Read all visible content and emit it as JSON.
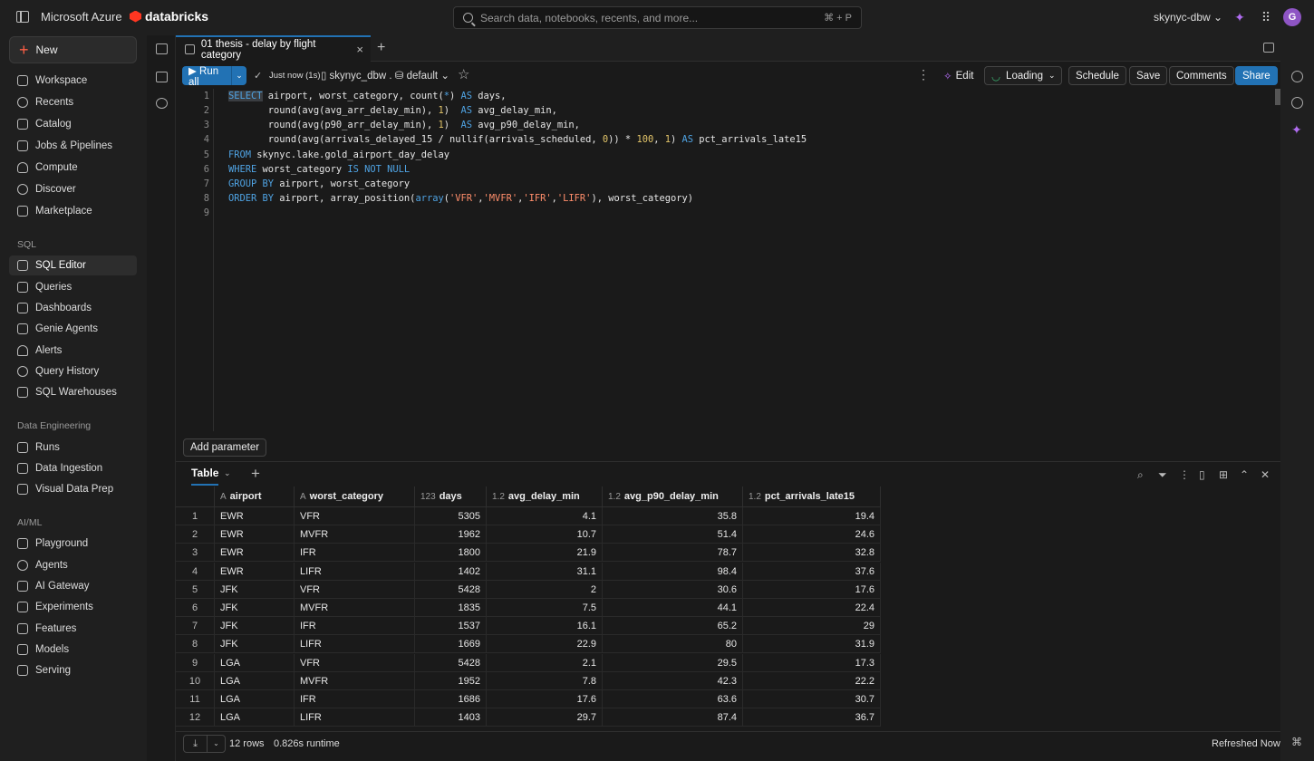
{
  "topbar": {
    "cloud_brand": "Microsoft Azure",
    "product_brand": "databricks",
    "search_placeholder": "Search data, notebooks, recents, and more...",
    "search_shortcut": "⌘ + P",
    "workspace": "skynyc-dbw",
    "avatar_initial": "G"
  },
  "sidebar": {
    "new_label": "New",
    "items_main": [
      "Workspace",
      "Recents",
      "Catalog",
      "Jobs & Pipelines",
      "Compute",
      "Discover",
      "Marketplace"
    ],
    "section_sql": "SQL",
    "items_sql": [
      "SQL Editor",
      "Queries",
      "Dashboards",
      "Genie Agents",
      "Alerts",
      "Query History",
      "SQL Warehouses"
    ],
    "section_de": "Data Engineering",
    "items_de": [
      "Runs",
      "Data Ingestion",
      "Visual Data Prep"
    ],
    "section_ai": "AI/ML",
    "items_ai": [
      "Playground",
      "Agents",
      "AI Gateway",
      "Experiments",
      "Features",
      "Models",
      "Serving"
    ],
    "active_item": "SQL Editor"
  },
  "tab": {
    "title": "01 thesis - delay by flight category"
  },
  "toolbar": {
    "run_all": "Run all",
    "status": "Just now (1s)",
    "catalog": "skynyc_dbw",
    "schema": "default",
    "edit": "Edit",
    "warehouse": "Loading",
    "schedule": "Schedule",
    "save": "Save",
    "comments": "Comments",
    "share": "Share"
  },
  "editor": {
    "line_numbers": [
      "1",
      "2",
      "3",
      "4",
      "5",
      "6",
      "7",
      "8",
      "9"
    ]
  },
  "add_parameter": "Add parameter",
  "results": {
    "tab_label": "Table",
    "columns": [
      {
        "name": "airport",
        "type_tag": "A"
      },
      {
        "name": "worst_category",
        "type_tag": "A"
      },
      {
        "name": "days",
        "type_tag": "123"
      },
      {
        "name": "avg_delay_min",
        "type_tag": "1.2"
      },
      {
        "name": "avg_p90_delay_min",
        "type_tag": "1.2"
      },
      {
        "name": "pct_arrivals_late15",
        "type_tag": "1.2"
      }
    ],
    "rows": [
      [
        "1",
        "EWR",
        "VFR",
        "5305",
        "4.1",
        "35.8",
        "19.4"
      ],
      [
        "2",
        "EWR",
        "MVFR",
        "1962",
        "10.7",
        "51.4",
        "24.6"
      ],
      [
        "3",
        "EWR",
        "IFR",
        "1800",
        "21.9",
        "78.7",
        "32.8"
      ],
      [
        "4",
        "EWR",
        "LIFR",
        "1402",
        "31.1",
        "98.4",
        "37.6"
      ],
      [
        "5",
        "JFK",
        "VFR",
        "5428",
        "2",
        "30.6",
        "17.6"
      ],
      [
        "6",
        "JFK",
        "MVFR",
        "1835",
        "7.5",
        "44.1",
        "22.4"
      ],
      [
        "7",
        "JFK",
        "IFR",
        "1537",
        "16.1",
        "65.2",
        "29"
      ],
      [
        "8",
        "JFK",
        "LIFR",
        "1669",
        "22.9",
        "80",
        "31.9"
      ],
      [
        "9",
        "LGA",
        "VFR",
        "5428",
        "2.1",
        "29.5",
        "17.3"
      ],
      [
        "10",
        "LGA",
        "MVFR",
        "1952",
        "7.8",
        "42.3",
        "22.2"
      ],
      [
        "11",
        "LGA",
        "IFR",
        "1686",
        "17.6",
        "63.6",
        "30.7"
      ],
      [
        "12",
        "LGA",
        "LIFR",
        "1403",
        "29.7",
        "87.4",
        "36.7"
      ]
    ],
    "row_count": "12 rows",
    "runtime": "0.826s runtime",
    "refreshed": "Refreshed Now"
  }
}
